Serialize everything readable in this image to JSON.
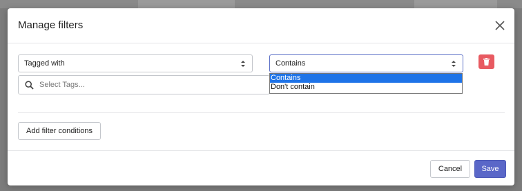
{
  "modal": {
    "title": "Manage filters"
  },
  "filter": {
    "type_value": "Tagged with",
    "condition_value": "Contains",
    "condition_options": [
      "Contains",
      "Don't contain"
    ],
    "tags_placeholder": "Select Tags..."
  },
  "actions": {
    "add_label": "Add filter conditions",
    "cancel_label": "Cancel",
    "save_label": "Save"
  },
  "colors": {
    "primary": "#5a67c8",
    "danger": "#e85a61",
    "selection": "#1e73e8"
  },
  "icons": {
    "close": "close-icon",
    "trash": "trash-icon",
    "search": "search-icon",
    "select_arrows": "updown-arrows-icon"
  }
}
